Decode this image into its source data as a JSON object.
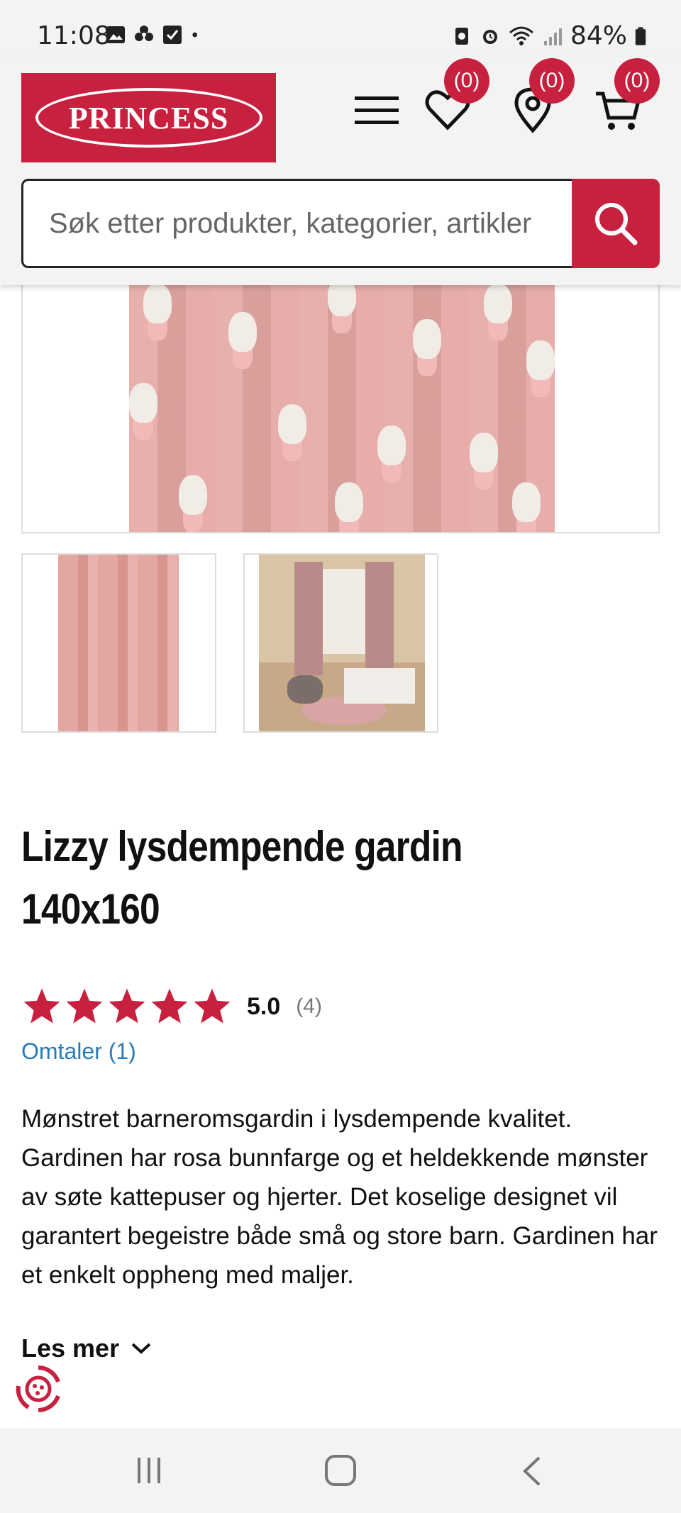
{
  "status_bar": {
    "time": "11:08",
    "battery": "84%"
  },
  "header": {
    "logo_text": "PRINCESS",
    "wishlist_count": "(0)",
    "stores_count": "(0)",
    "cart_count": "(0)",
    "search_placeholder": "Søk etter produkter, kategorier, artikler"
  },
  "product": {
    "title": "Lizzy lysdempende gardin 140x160",
    "rating_value": "5.0",
    "rating_count": "(4)",
    "reviews_link": "Omtaler (1)",
    "description": "Mønstret barneromsgardin i lysdempende kvalitet. Gardinen har rosa bunnfarge og et heldekkende mønster av søte kattepuser og hjerter. Det koselige designet vil garantert begeistre både små og store barn. Gardinen har et enkelt oppheng med maljer.",
    "read_more": "Les mer"
  },
  "colors": {
    "brand_red": "#c8203f",
    "link_blue": "#2a7ab8",
    "curtain_pink": "#e6a9a5"
  }
}
